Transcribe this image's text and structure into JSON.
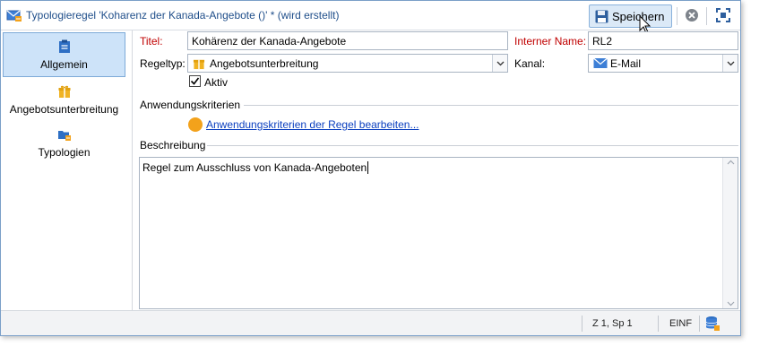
{
  "window": {
    "title": "Typologieregel 'Koharenz der Kanada-Angebote ()' * (wird erstellt)",
    "title_icon": "typology-rule-icon"
  },
  "toolbar": {
    "save_label": "Speichern",
    "save_icon": "floppy-disk-icon",
    "close_icon": "close-circle-icon",
    "fullscreen_icon": "fullscreen-icon"
  },
  "sidebar": {
    "items": [
      {
        "label": "Allgemein",
        "icon": "clipboard-icon",
        "active": true
      },
      {
        "label": "Angebotsunterbreitung",
        "icon": "gift-icon",
        "active": false
      },
      {
        "label": "Typologien",
        "icon": "typology-folder-icon",
        "active": false
      }
    ]
  },
  "form": {
    "title_label": "Titel:",
    "title_value": "Kohärenz der Kanada-Angebote",
    "internal_name_label": "Interner Name:",
    "internal_name_value": "RL2",
    "rule_type_label": "Regeltyp:",
    "rule_type_value": "Angebotsunterbreitung",
    "channel_label": "Kanal:",
    "channel_value": "E-Mail",
    "active_label": "Aktiv",
    "active_checked": true,
    "criteria_section": "Anwendungskriterien",
    "criteria_link": "Anwendungskriterien der Regel bearbeiten...",
    "description_section": "Beschreibung",
    "description_value": "Regel zum Ausschluss von Kanada-Angeboten"
  },
  "statusbar": {
    "position": "Z 1, Sp 1",
    "mode": "EINF"
  },
  "colors": {
    "accent": "#1f4e8a",
    "required_label": "#c00000",
    "link": "#0b3fbf",
    "active_nav_bg": "#cde3f9"
  }
}
